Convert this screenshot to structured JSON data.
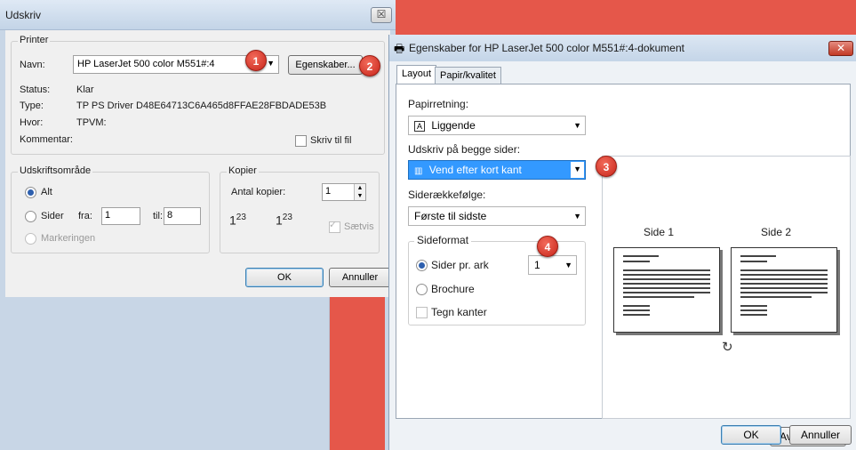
{
  "left": {
    "title": "Udskriv",
    "close_glyph": "☒",
    "printer": {
      "legend": "Printer",
      "name_label": "Navn:",
      "name_value": "HP LaserJet 500 color M551#:4",
      "properties_button": "Egenskaber...",
      "status_label": "Status:",
      "status_value": "Klar",
      "type_label": "Type:",
      "type_value": "TP PS Driver D48E64713C6A465d8FFAE28FBDADE53B",
      "where_label": "Hvor:",
      "where_value": "TPVM:",
      "comment_label": "Kommentar:",
      "print_to_file": "Skriv til fil"
    },
    "range": {
      "legend": "Udskriftsområde",
      "all": "Alt",
      "pages": "Sider",
      "from_label": "fra:",
      "from_value": "1",
      "to_label": "til:",
      "to_value": "8",
      "selection": "Markeringen"
    },
    "copies": {
      "legend": "Kopier",
      "count_label": "Antal kopier:",
      "count_value": "1",
      "collate": "Sætvis"
    },
    "ok": "OK",
    "cancel": "Annuller"
  },
  "right": {
    "title": "Egenskaber for HP LaserJet 500 color M551#:4-dokument",
    "close_glyph": "✕",
    "tabs": [
      "Layout",
      "Papir/kvalitet"
    ],
    "orientation_label": "Papirretning:",
    "orientation_value": "Liggende",
    "duplex_label": "Udskriv på begge sider:",
    "duplex_value": "Vend efter kort kant",
    "order_label": "Siderækkefølge:",
    "order_value": "Første til sidste",
    "format_legend": "Sideformat",
    "pages_per_sheet_label": "Sider pr. ark",
    "pages_per_sheet_value": "1",
    "brochure": "Brochure",
    "draw_borders": "Tegn kanter",
    "preview_page1": "Side 1",
    "preview_page2": "Side 2",
    "advanced": "Avanceret...",
    "ok": "OK",
    "cancel": "Annuller"
  },
  "callouts": [
    "1",
    "2",
    "3",
    "4"
  ],
  "colors": {
    "background": "#e5574a",
    "badge": "#d93a2b",
    "selection": "#3399ff"
  }
}
